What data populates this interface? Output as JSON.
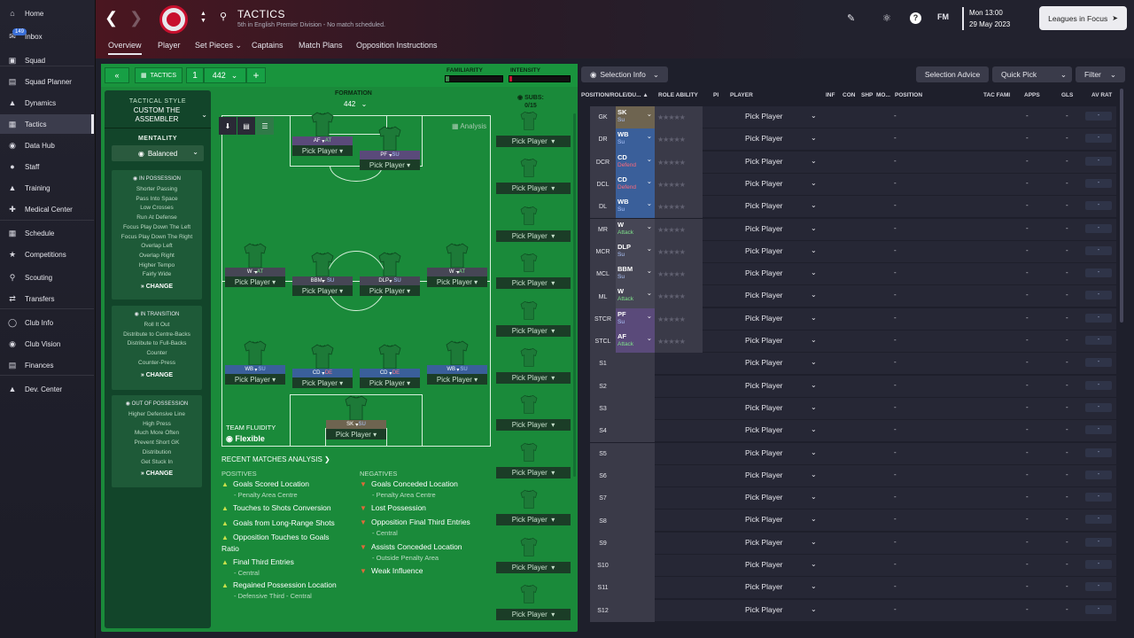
{
  "sidebar": {
    "inbox_badge": "149",
    "items": [
      {
        "label": "Home",
        "icon": "home-icon"
      },
      {
        "label": "Inbox",
        "icon": "inbox-icon"
      },
      {
        "label": "Squad",
        "icon": "shirt-icon"
      },
      {
        "label": "Squad Planner",
        "icon": "squad-planner-icon"
      },
      {
        "label": "Dynamics",
        "icon": "dynamics-icon"
      },
      {
        "label": "Tactics",
        "icon": "tactics-icon"
      },
      {
        "label": "Data Hub",
        "icon": "data-hub-icon"
      },
      {
        "label": "Staff",
        "icon": "staff-icon"
      },
      {
        "label": "Training",
        "icon": "training-icon"
      },
      {
        "label": "Medical Center",
        "icon": "medical-icon"
      },
      {
        "label": "Schedule",
        "icon": "schedule-icon"
      },
      {
        "label": "Competitions",
        "icon": "trophy-icon"
      },
      {
        "label": "Scouting",
        "icon": "scouting-icon"
      },
      {
        "label": "Transfers",
        "icon": "transfers-icon"
      },
      {
        "label": "Club Info",
        "icon": "club-info-icon"
      },
      {
        "label": "Club Vision",
        "icon": "club-vision-icon"
      },
      {
        "label": "Finances",
        "icon": "finances-icon"
      },
      {
        "label": "Dev. Center",
        "icon": "dev-center-icon"
      }
    ]
  },
  "header": {
    "title": "TACTICS",
    "subtitle": "5th in English Premier Division - No match scheduled.",
    "tabs": [
      "Overview",
      "Player",
      "Set Pieces",
      "Captains",
      "Match Plans",
      "Opposition Instructions"
    ],
    "fm_label": "FM",
    "date_line1": "Mon 13:00",
    "date_line2": "29 May 2023",
    "leagues_button": "Leagues in Focus"
  },
  "tactics_bar": {
    "tactics_label": "TACTICS",
    "slot": "1",
    "formation_select": "442",
    "familiarity_label": "FAMILIARITY",
    "intensity_label": "INTENSITY",
    "familiarity_fraction": 0.06,
    "intensity_fraction": 0.04
  },
  "left_col": {
    "tactical_style_label": "TACTICAL STYLE",
    "style_name": "CUSTOM THE ASSEMBLER",
    "mentality_label": "MENTALITY",
    "mentality_value": "Balanced",
    "in_possession_title": "IN POSSESSION",
    "in_possession": [
      "Shorter Passing",
      "Pass Into Space",
      "Low Crosses",
      "Run At Defense",
      "Focus Play Down The Left",
      "Focus Play Down The Right",
      "Overlap Left",
      "Overlap Right",
      "Higher Tempo",
      "Fairly Wide"
    ],
    "in_transition_title": "IN TRANSITION",
    "in_transition": [
      "Roll It Out",
      "Distribute to Centre-Backs",
      "Distribute to Full-Backs",
      "Counter",
      "Counter-Press"
    ],
    "out_possession_title": "OUT OF POSSESSION",
    "out_possession": [
      "Higher Defensive Line",
      "High Press",
      "Much More Often",
      "Prevent Short GK",
      "Distribution",
      "Get Stuck In"
    ],
    "change_label": "CHANGE"
  },
  "pitch": {
    "formation_label": "FORMATION",
    "formation_value": "442",
    "analysis_label": "Analysis",
    "team_fluidity_label": "TEAM FLUIDITY",
    "team_fluidity_value": "Flexible",
    "pick_label": "Pick Player",
    "players": [
      {
        "role": "AF",
        "duty": "AT"
      },
      {
        "role": "PF",
        "duty": "SU"
      },
      {
        "role": "W",
        "duty": "AT"
      },
      {
        "role": "BBM",
        "duty": "SU"
      },
      {
        "role": "DLP",
        "duty": "SU"
      },
      {
        "role": "W",
        "duty": "AT"
      },
      {
        "role": "WB",
        "duty": "SU"
      },
      {
        "role": "CD",
        "duty": "DE"
      },
      {
        "role": "CD",
        "duty": "DE"
      },
      {
        "role": "WB",
        "duty": "SU"
      },
      {
        "role": "SK",
        "duty": "SU"
      }
    ]
  },
  "subs": {
    "label": "SUBS:",
    "count": "0/15",
    "pick_label": "Pick Player"
  },
  "analysis": {
    "title": "RECENT MATCHES ANALYSIS",
    "positives_label": "POSITIVES",
    "negatives_label": "NEGATIVES",
    "positives": [
      {
        "text": "Goals Scored Location",
        "sub": "- Penalty Area Centre"
      },
      {
        "text": "Touches to Shots Conversion",
        "sub": ""
      },
      {
        "text": "Goals from Long-Range Shots",
        "sub": ""
      },
      {
        "text": "Opposition Touches to Goals Ratio",
        "sub": ""
      },
      {
        "text": "Final Third Entries",
        "sub": "- Central"
      },
      {
        "text": "Regained Possession Location",
        "sub": "- Defensive Third - Central"
      }
    ],
    "negatives": [
      {
        "text": "Goals Conceded Location",
        "sub": "- Penalty Area Centre"
      },
      {
        "text": "Lost Possession",
        "sub": ""
      },
      {
        "text": "Opposition Final Third Entries",
        "sub": "- Central"
      },
      {
        "text": "Assists Conceded Location",
        "sub": "- Outside Penalty Area"
      },
      {
        "text": "Weak Influence",
        "sub": ""
      }
    ]
  },
  "right_panel": {
    "selection_info": "Selection Info",
    "selection_advice": "Selection Advice",
    "quick_pick": "Quick Pick",
    "filter": "Filter",
    "columns": [
      "POSITION/ROLE/DU...",
      "ROLE ABILITY",
      "PI",
      "PLAYER",
      "INF",
      "CON",
      "SHP",
      "MO...",
      "POSITION",
      "TAC FAMI",
      "APPS",
      "GLS",
      "AV RAT"
    ],
    "pick_label": "Pick Player",
    "dash": "-",
    "rows": [
      {
        "pos": "GK",
        "role": "SK",
        "duty": "Su",
        "color": "#6e6450",
        "duty_color": "#b0c8ff"
      },
      {
        "pos": "DR",
        "role": "WB",
        "duty": "Su",
        "color": "#3a5f9a",
        "duty_color": "#b0c8ff"
      },
      {
        "pos": "DCR",
        "role": "CD",
        "duty": "Defend",
        "color": "#3a5f9a",
        "duty_color": "#ff6a7a"
      },
      {
        "pos": "DCL",
        "role": "CD",
        "duty": "Defend",
        "color": "#3a5f9a",
        "duty_color": "#ff6a7a"
      },
      {
        "pos": "DL",
        "role": "WB",
        "duty": "Su",
        "color": "#3a5f9a",
        "duty_color": "#b0c8ff"
      },
      {
        "pos": "MR",
        "role": "W",
        "duty": "Attack",
        "color": "#464655",
        "duty_color": "#7ee08a"
      },
      {
        "pos": "MCR",
        "role": "DLP",
        "duty": "Su",
        "color": "#464655",
        "duty_color": "#b0c8ff"
      },
      {
        "pos": "MCL",
        "role": "BBM",
        "duty": "Su",
        "color": "#464655",
        "duty_color": "#b0c8ff"
      },
      {
        "pos": "ML",
        "role": "W",
        "duty": "Attack",
        "color": "#464655",
        "duty_color": "#7ee08a"
      },
      {
        "pos": "STCR",
        "role": "PF",
        "duty": "Su",
        "color": "#5a4a7a",
        "duty_color": "#b0c8ff"
      },
      {
        "pos": "STCL",
        "role": "AF",
        "duty": "Attack",
        "color": "#5a4a7a",
        "duty_color": "#7ee08a"
      },
      {
        "pos": "S1"
      },
      {
        "pos": "S2"
      },
      {
        "pos": "S3"
      },
      {
        "pos": "S4"
      },
      {
        "pos": "S5"
      },
      {
        "pos": "S6"
      },
      {
        "pos": "S7"
      },
      {
        "pos": "S8"
      },
      {
        "pos": "S9"
      },
      {
        "pos": "S10"
      },
      {
        "pos": "S11"
      },
      {
        "pos": "S12"
      }
    ]
  },
  "colors": {
    "pitch_green": "#1a8a3a",
    "club_red": "#c8102e",
    "familiarity_fill": "#3a8a4a",
    "intensity_fill": "#c8102e"
  }
}
